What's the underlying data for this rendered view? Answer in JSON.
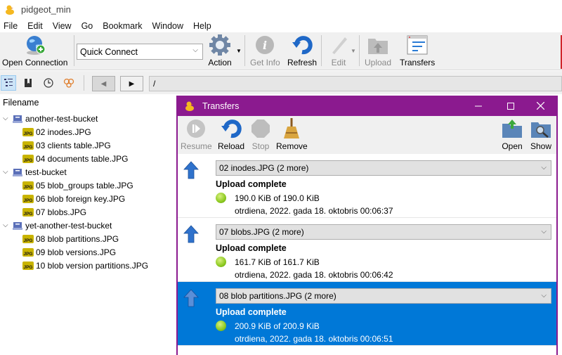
{
  "app": {
    "title": "pidgeot_min"
  },
  "menu": [
    "File",
    "Edit",
    "View",
    "Go",
    "Bookmark",
    "Window",
    "Help"
  ],
  "toolbar": {
    "open_connection": "Open Connection",
    "quick_connect": "Quick Connect",
    "action": "Action",
    "get_info": "Get Info",
    "refresh": "Refresh",
    "edit": "Edit",
    "upload": "Upload",
    "transfers": "Transfers"
  },
  "navbar": {
    "path": "/"
  },
  "browser": {
    "column_header": "Filename",
    "buckets": [
      {
        "name": "another-test-bucket",
        "files": [
          "02 inodes.JPG",
          "03 clients table.JPG",
          "04 documents table.JPG"
        ]
      },
      {
        "name": "test-bucket",
        "files": [
          "05 blob_groups table.JPG",
          "06 blob foreign key.JPG",
          "07 blobs.JPG"
        ]
      },
      {
        "name": "yet-another-test-bucket",
        "files": [
          "08 blob partitions.JPG",
          "09 blob versions.JPG",
          "10 blob version partitions.JPG"
        ]
      }
    ],
    "file_icon_text": "JPG"
  },
  "transfers": {
    "title": "Transfers",
    "toolbar": {
      "resume": "Resume",
      "reload": "Reload",
      "stop": "Stop",
      "remove": "Remove",
      "open": "Open",
      "show": "Show"
    },
    "items": [
      {
        "name": "02 inodes.JPG (2 more)",
        "status": "Upload complete",
        "size": "190.0 KiB of 190.0 KiB",
        "date": "otrdiena, 2022. gada 18. oktobris 00:06:37",
        "selected": false
      },
      {
        "name": "07 blobs.JPG (2 more)",
        "status": "Upload complete",
        "size": "161.7 KiB of 161.7 KiB",
        "date": "otrdiena, 2022. gada 18. oktobris 00:06:42",
        "selected": false
      },
      {
        "name": "08 blob partitions.JPG (2 more)",
        "status": "Upload complete",
        "size": "200.9 KiB of 200.9 KiB",
        "date": "otrdiena, 2022. gada 18. oktobris 00:06:51",
        "selected": true
      }
    ]
  },
  "colors": {
    "transfers_titlebar": "#8b1a8f",
    "selection": "#0078d7",
    "status_ok": "#8cc920"
  }
}
